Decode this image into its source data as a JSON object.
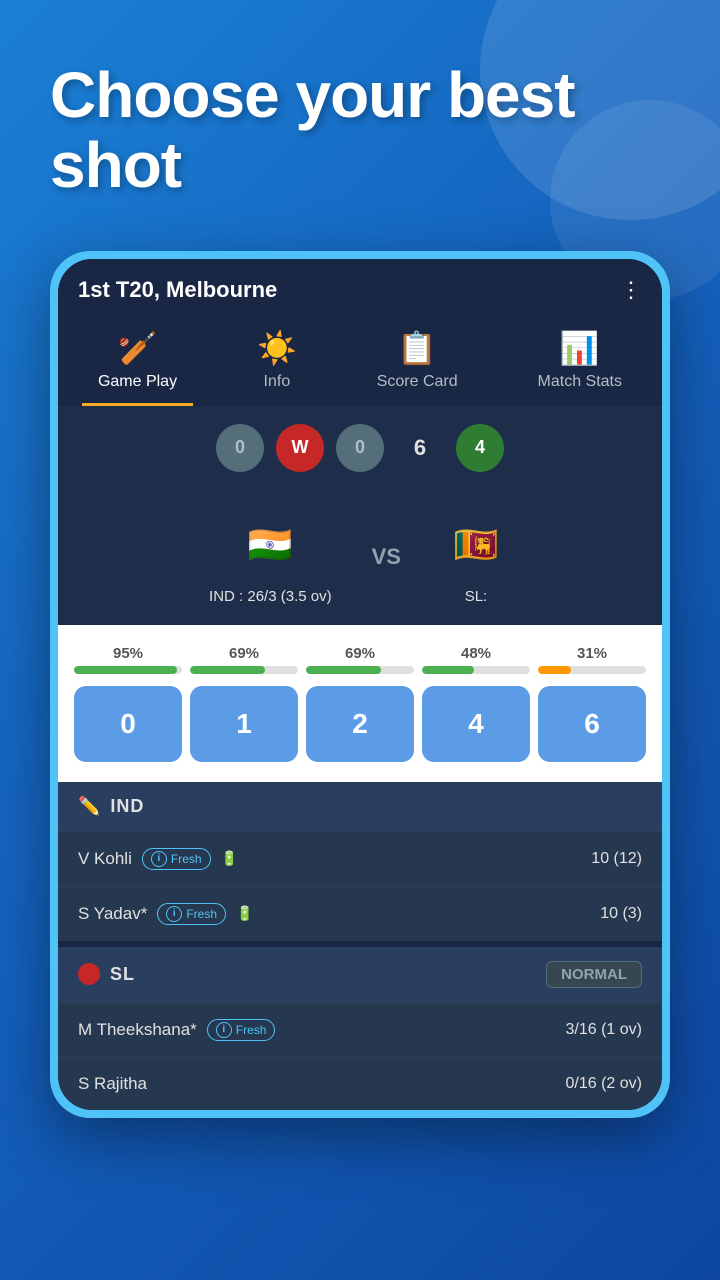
{
  "headline": {
    "text": "Choose your best shot"
  },
  "match": {
    "title": "1st T20, Melbourne",
    "ind_score": "IND : 26/3 (3.5 ov)",
    "sl_score": "SL:",
    "vs_label": "VS"
  },
  "nav": {
    "tabs": [
      {
        "id": "gameplay",
        "label": "Game Play",
        "icon": "🏏",
        "active": true
      },
      {
        "id": "info",
        "label": "Info",
        "icon": "☀️",
        "active": false
      },
      {
        "id": "scorecard",
        "label": "Score Card",
        "icon": "📋",
        "active": false
      },
      {
        "id": "matchstats",
        "label": "Match Stats",
        "icon": "📊",
        "active": false
      }
    ]
  },
  "score_balls": [
    {
      "value": "0",
      "type": "gray"
    },
    {
      "value": "W",
      "type": "red"
    },
    {
      "value": "0",
      "type": "gray"
    },
    {
      "value": "6",
      "type": "number"
    },
    {
      "value": "4",
      "type": "green"
    }
  ],
  "shot_options": [
    {
      "value": "0",
      "pct": "95%",
      "bar_pct": 95,
      "bar_color": "#4caf50"
    },
    {
      "value": "1",
      "pct": "69%",
      "bar_pct": 69,
      "bar_color": "#4caf50"
    },
    {
      "value": "2",
      "pct": "69%",
      "bar_pct": 69,
      "bar_color": "#4caf50"
    },
    {
      "value": "4",
      "pct": "48%",
      "bar_pct": 48,
      "bar_color": "#4caf50"
    },
    {
      "value": "6",
      "pct": "31%",
      "bar_pct": 31,
      "bar_color": "#ff9800"
    }
  ],
  "ind_team": {
    "name": "IND",
    "icon": "✏️",
    "players": [
      {
        "name": "V Kohli",
        "fresh": true,
        "score": "10 (12)"
      },
      {
        "name": "S Yadav*",
        "fresh": true,
        "score": "10 (3)"
      }
    ]
  },
  "sl_team": {
    "name": "SL",
    "difficulty": "NORMAL",
    "players": [
      {
        "name": "M Theekshana*",
        "fresh": true,
        "score": "3/16 (1 ov)"
      },
      {
        "name": "S Rajitha",
        "fresh": false,
        "score": "0/16 (2 ov)"
      }
    ]
  }
}
